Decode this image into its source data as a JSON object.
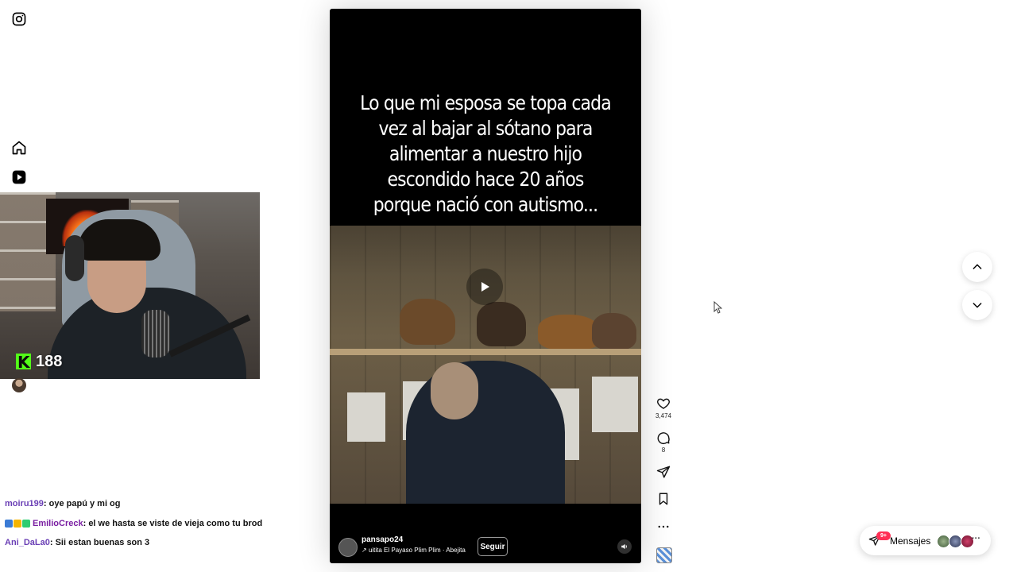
{
  "sidebar": {
    "items": [
      {
        "icon": "instagram-icon"
      },
      {
        "icon": "home-icon"
      },
      {
        "icon": "reels-icon"
      }
    ]
  },
  "stream_overlay": {
    "viewer_count": "188"
  },
  "chat": {
    "messages": [
      {
        "user": "moiru199",
        "text": ": oye papú y mi og"
      },
      {
        "user": "EmilioCreck",
        "text": ": el we hasta se viste de vieja como tu brod"
      },
      {
        "user": "Ani_DaLa0",
        "text": ": Sii estan buenas son 3"
      }
    ]
  },
  "reel": {
    "caption": "Lo que mi esposa se topa cada vez al bajar al sótano para alimentar a nuestro hijo escondido hace 20 años porque nació con autismo...",
    "author": "pansapo24",
    "audio": "uitita  El Payaso Plim Plim · Abejita",
    "follow_label": "Seguir"
  },
  "actions": {
    "like_count": "3,474",
    "comment_count": "8"
  },
  "messages_pill": {
    "label": "Mensajes",
    "badge": "9+"
  },
  "colors": {
    "accent_kick": "#53fc18",
    "badge_red": "#ff2f55",
    "chat_username": "#6a3fb5"
  }
}
